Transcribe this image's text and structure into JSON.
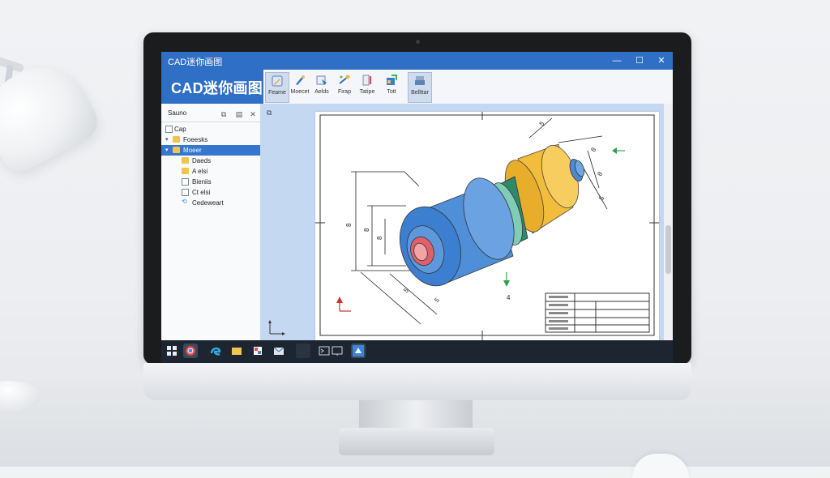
{
  "window": {
    "title": "CAD迷你画图",
    "controls": {
      "minimize": "—",
      "maximize": "☐",
      "close": "✕"
    }
  },
  "app": {
    "name": "CAD迷你画图"
  },
  "ribbon": {
    "tools": [
      {
        "label": "Feame",
        "icon": "pencil-icon",
        "active": true
      },
      {
        "label": "Moecet",
        "icon": "brush-icon",
        "active": false
      },
      {
        "label": "Aelds",
        "icon": "layers-icon",
        "active": false
      },
      {
        "label": "Firap",
        "icon": "wand-icon",
        "active": false
      },
      {
        "label": "Tatipe",
        "icon": "pen-tablet-icon",
        "active": false
      },
      {
        "label": "Tott",
        "icon": "export-icon",
        "active": false
      },
      {
        "label": "Bellttar",
        "icon": "print-icon",
        "active": true
      }
    ]
  },
  "sidebar": {
    "title": "Sauno",
    "items": [
      {
        "label": "Cap",
        "icon": "file-icon",
        "selected": false,
        "indent": 0,
        "arrow": ""
      },
      {
        "label": "Foeesks",
        "icon": "folder-icon",
        "selected": false,
        "indent": 1,
        "arrow": "▾"
      },
      {
        "label": "Moeer",
        "icon": "folder-icon",
        "selected": true,
        "indent": 1,
        "arrow": "▾"
      },
      {
        "label": "Daeds",
        "icon": "folder-icon",
        "selected": false,
        "indent": 2,
        "arrow": ""
      },
      {
        "label": "A elsi",
        "icon": "folder-icon",
        "selected": false,
        "indent": 2,
        "arrow": ""
      },
      {
        "label": "Bieniis",
        "icon": "document-icon",
        "selected": false,
        "indent": 2,
        "arrow": ""
      },
      {
        "label": "Ct elsi",
        "icon": "document-icon",
        "selected": false,
        "indent": 2,
        "arrow": ""
      },
      {
        "label": "Cedeweart",
        "icon": "link-icon",
        "selected": false,
        "indent": 2,
        "arrow": ""
      }
    ]
  },
  "drawing": {
    "dimension_labels": [
      "8",
      "8",
      "8",
      "5",
      "5",
      "5",
      "8",
      "8",
      "5",
      "4"
    ]
  },
  "taskbar": {
    "apps": [
      "windows-start-icon",
      "browser-icon",
      "edge-icon",
      "file-explorer-icon",
      "store-icon",
      "mail-icon",
      "console-icon",
      "monitor-icon",
      "cad-app-icon"
    ]
  },
  "colors": {
    "accent": "#2f6fc6",
    "selection": "#3576cf",
    "canvas_bg": "#c5d8f1",
    "part_blue": "#4f8fd8",
    "part_yellow": "#f2bd3c",
    "part_green": "#2f8a6b",
    "bore_red": "#e0606a"
  }
}
